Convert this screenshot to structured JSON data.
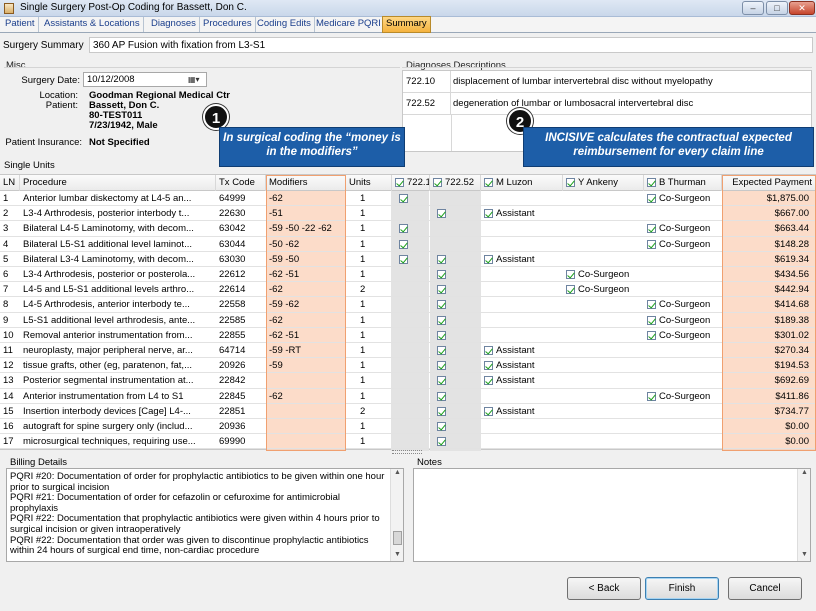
{
  "window": {
    "title": "Single Surgery Post-Op Coding for Bassett, Don C.",
    "buttons": {
      "minimize": "–",
      "maximize": "□",
      "close": "✕"
    }
  },
  "tabs": [
    {
      "label": "Patient"
    },
    {
      "label": "Assistants & Locations"
    },
    {
      "label": "Diagnoses"
    },
    {
      "label": "Procedures"
    },
    {
      "label": "Coding Edits"
    },
    {
      "label": "Medicare PQRI"
    },
    {
      "label": "Summary",
      "active": true
    }
  ],
  "summary": {
    "label": "Surgery Summary",
    "value": "360 AP Fusion with fixation from L3-S1"
  },
  "misc": {
    "title": "Misc",
    "surgery_date_label": "Surgery Date:",
    "surgery_date": "10/12/2008",
    "location_label": "Location:",
    "location": "Goodman Regional Medical Ctr",
    "patient_label": "Patient:",
    "patient_lines": [
      "Bassett, Don C.",
      "80-TEST011",
      "7/23/1942, Male"
    ],
    "insurance_label": "Patient Insurance:",
    "insurance": "Not Specified"
  },
  "diagnoses": {
    "title": "Diagnoses Descriptions",
    "rows": [
      {
        "code": "722.10",
        "desc": "displacement of lumbar intervertebral disc without myelopathy"
      },
      {
        "code": "722.52",
        "desc": "degeneration of lumbar or lumbosacral intervertebral disc"
      }
    ]
  },
  "annotations": [
    {
      "number": "1",
      "text": "In surgical coding the “money is in the modifiers”"
    },
    {
      "number": "2",
      "text": "INCISIVE calculates the contractual expected reimbursement for every claim line"
    }
  ],
  "single_units": {
    "title": "Single Units",
    "headers": {
      "ln": "LN",
      "procedure": "Procedure",
      "tx": "Tx Code",
      "modifiers": "Modifiers",
      "units": "Units",
      "d1": "722.10",
      "d2": "722.52",
      "s1": "M Luzon",
      "s2": "Y Ankeny",
      "s3": "B Thurman",
      "payment": "Expected Payment"
    },
    "rows": [
      {
        "ln": "1",
        "proc": "Anterior lumbar diskectomy at L4-5 an...",
        "tx": "64999",
        "mod": "-62",
        "units": "1",
        "d1": true,
        "d2": false,
        "s1": "",
        "s2": "",
        "s3": "Co-Surgeon",
        "pay": "$1,875.00"
      },
      {
        "ln": "2",
        "proc": "L3-4 Arthrodesis, posterior interbody t...",
        "tx": "22630",
        "mod": "-51",
        "units": "1",
        "d1": false,
        "d2": true,
        "s1": "Assistant",
        "s2": "",
        "s3": "",
        "pay": "$667.00"
      },
      {
        "ln": "3",
        "proc": "Bilateral L4-5 Laminotomy, with decom...",
        "tx": "63042",
        "mod": "-59 -50 -22 -62",
        "units": "1",
        "d1": true,
        "d2": false,
        "s1": "",
        "s2": "",
        "s3": "Co-Surgeon",
        "pay": "$663.44"
      },
      {
        "ln": "4",
        "proc": "Bilateral L5-S1 additional level laminot...",
        "tx": "63044",
        "mod": "-50 -62",
        "units": "1",
        "d1": true,
        "d2": false,
        "s1": "",
        "s2": "",
        "s3": "Co-Surgeon",
        "pay": "$148.28"
      },
      {
        "ln": "5",
        "proc": "Bilateral L3-4 Laminotomy, with decom...",
        "tx": "63030",
        "mod": "-59 -50",
        "units": "1",
        "d1": true,
        "d2": true,
        "s1": "Assistant",
        "s2": "",
        "s3": "",
        "pay": "$619.34"
      },
      {
        "ln": "6",
        "proc": "L3-4 Arthrodesis, posterior or posterola...",
        "tx": "22612",
        "mod": "-62 -51",
        "units": "1",
        "d1": false,
        "d2": true,
        "s1": "",
        "s2": "Co-Surgeon",
        "s3": "",
        "pay": "$434.56"
      },
      {
        "ln": "7",
        "proc": "L4-5 and L5-S1 additional levels arthro...",
        "tx": "22614",
        "mod": "-62",
        "units": "2",
        "d1": false,
        "d2": true,
        "s1": "",
        "s2": "Co-Surgeon",
        "s3": "",
        "pay": "$442.94"
      },
      {
        "ln": "8",
        "proc": "L4-5 Arthrodesis, anterior interbody te...",
        "tx": "22558",
        "mod": "-59 -62",
        "units": "1",
        "d1": false,
        "d2": true,
        "s1": "",
        "s2": "",
        "s3": "Co-Surgeon",
        "pay": "$414.68"
      },
      {
        "ln": "9",
        "proc": "L5-S1 additional level arthrodesis, ante...",
        "tx": "22585",
        "mod": "-62",
        "units": "1",
        "d1": false,
        "d2": true,
        "s1": "",
        "s2": "",
        "s3": "Co-Surgeon",
        "pay": "$189.38"
      },
      {
        "ln": "10",
        "proc": "Removal anterior instrumentation from...",
        "tx": "22855",
        "mod": "-62 -51",
        "units": "1",
        "d1": false,
        "d2": true,
        "s1": "",
        "s2": "",
        "s3": "Co-Surgeon",
        "pay": "$301.02"
      },
      {
        "ln": "11",
        "proc": "neuroplasty, major peripheral nerve, ar...",
        "tx": "64714",
        "mod": "-59 -RT",
        "units": "1",
        "d1": false,
        "d2": true,
        "s1": "Assistant",
        "s2": "",
        "s3": "",
        "pay": "$270.34"
      },
      {
        "ln": "12",
        "proc": "tissue grafts, other (eg, paratenon, fat,...",
        "tx": "20926",
        "mod": "-59",
        "units": "1",
        "d1": false,
        "d2": true,
        "s1": "Assistant",
        "s2": "",
        "s3": "",
        "pay": "$194.53"
      },
      {
        "ln": "13",
        "proc": "Posterior segmental instrumentation at...",
        "tx": "22842",
        "mod": "",
        "units": "1",
        "d1": false,
        "d2": true,
        "s1": "Assistant",
        "s2": "",
        "s3": "",
        "pay": "$692.69"
      },
      {
        "ln": "14",
        "proc": "Anterior instrumentation from L4 to S1",
        "tx": "22845",
        "mod": "-62",
        "units": "1",
        "d1": false,
        "d2": true,
        "s1": "",
        "s2": "",
        "s3": "Co-Surgeon",
        "pay": "$411.86"
      },
      {
        "ln": "15",
        "proc": "Insertion interbody devices [Cage] L4-...",
        "tx": "22851",
        "mod": "",
        "units": "2",
        "d1": false,
        "d2": true,
        "s1": "Assistant",
        "s2": "",
        "s3": "",
        "pay": "$734.77"
      },
      {
        "ln": "16",
        "proc": "autograft for spine surgery only (includ...",
        "tx": "20936",
        "mod": "",
        "units": "1",
        "d1": false,
        "d2": true,
        "s1": "",
        "s2": "",
        "s3": "",
        "pay": "$0.00"
      },
      {
        "ln": "17",
        "proc": "microsurgical techniques, requiring use...",
        "tx": "69990",
        "mod": "",
        "units": "1",
        "d1": false,
        "d2": true,
        "s1": "",
        "s2": "",
        "s3": "",
        "pay": "$0.00"
      }
    ]
  },
  "billing": {
    "title": "Billing Details",
    "text": "PQRI #20: Documentation of order for prophylactic antibiotics to be given within one hour prior to surgical incision\nPQRI #21: Documentation of order for cefazolin or cefuroxime for antimicrobial prophylaxis\nPQRI #22: Documentation that prophylactic antibiotics were given within 4 hours prior to surgical incision or given intraoperatively\nPQRI #22: Documentation that order was given to discontinue prophylactic antibiotics within 24 hours of surgical end time, non-cardiac procedure"
  },
  "notes": {
    "title": "Notes",
    "value": ""
  },
  "buttons": {
    "back": "< Back",
    "finish": "Finish",
    "cancel": "Cancel"
  },
  "colors": {
    "accent_tab": "#f5b23e",
    "callout": "#1d5ea8",
    "highlight": "#fbd6c0",
    "link": "#1a3e8c"
  }
}
